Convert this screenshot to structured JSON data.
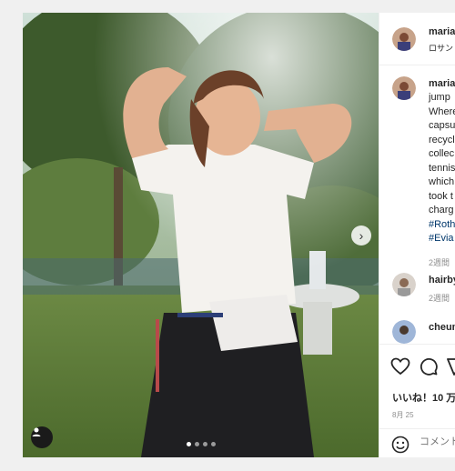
{
  "post": {
    "author": "maria",
    "location": "ロサン",
    "carousel_dots": 4,
    "active_dot": 0
  },
  "caption": {
    "author": "maria",
    "lines": [
      "jump",
      "Where",
      "capsu",
      "recycl",
      "collec",
      "tennis",
      "which",
      "took t",
      "charg"
    ],
    "hashtags": [
      "#Roth",
      "#Evia"
    ],
    "time": "2週間"
  },
  "comments": [
    {
      "author": "hairby",
      "time": "2週間"
    },
    {
      "author": "cheun",
      "time": ""
    }
  ],
  "actions": {
    "likes_text": "いいね！10 万",
    "date": "8月 25",
    "comment_placeholder": "コメント"
  },
  "icons": {
    "like": "heart-icon",
    "comment": "comment-bubble-icon",
    "share": "paper-plane-icon",
    "emoji": "smiley-icon",
    "next": "chevron-right-icon",
    "tag": "user-tag-icon"
  },
  "colors": {
    "hashtag": "#00376b",
    "text": "#262626",
    "muted": "#8e8e8e"
  }
}
